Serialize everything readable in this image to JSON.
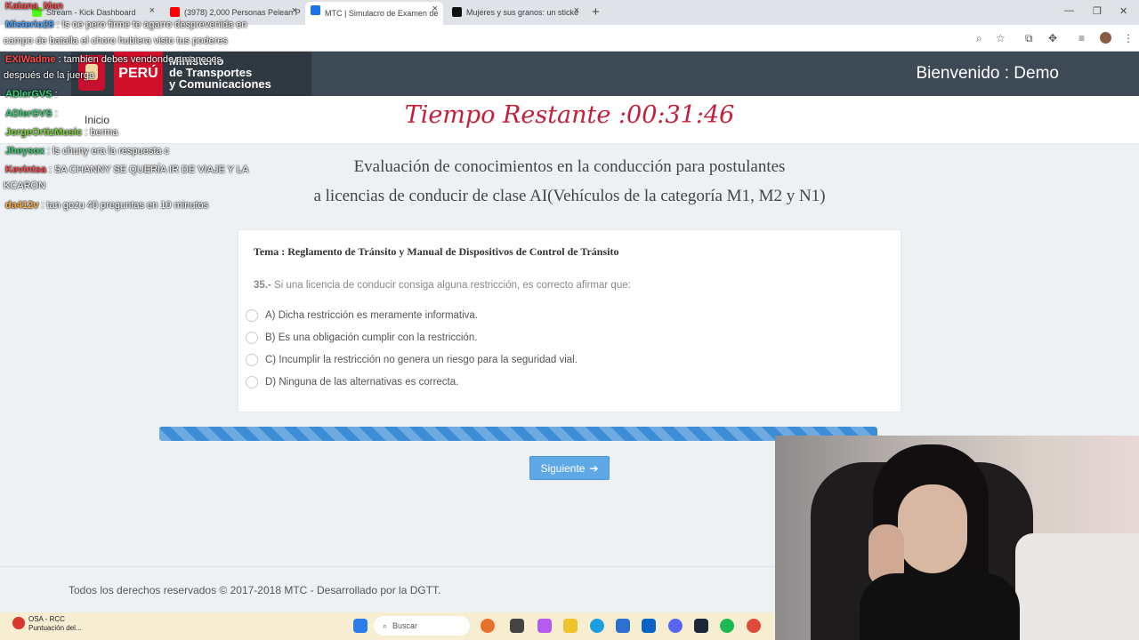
{
  "browser": {
    "tabs": [
      {
        "label": "Stream - Kick Dashboard",
        "color": "#53fc18"
      },
      {
        "label": "(3978) 2,000 Personas Pelean P",
        "color": "#ff0000"
      },
      {
        "label": "MTC | Simulacro de Examen de",
        "color": "#1a73e8"
      },
      {
        "label": "Mujeres y sus granos: un sticke",
        "color": "#111111"
      }
    ]
  },
  "header": {
    "logo_peru": "PERÚ",
    "logo_ministry_line1": "Ministerio",
    "logo_ministry_line2": "de Transportes",
    "logo_ministry_line3": "y Comunicaciones",
    "welcome": "Bienvenido : Demo"
  },
  "nav": {
    "inicio": "Inicio"
  },
  "timer": {
    "label": "Tiempo Restante :",
    "value": "00:31:46"
  },
  "exam": {
    "title_line1": "Evaluación de conocimientos en la conducción para postulantes",
    "title_line2": "a licencias de conducir de clase AI(Vehículos de la categoría M1, M2 y N1)",
    "tema": "Tema : Reglamento de Tránsito y Manual de Dispositivos de Control de Tránsito",
    "question_number": "35.-",
    "question_text": "Si una licencia de conducir consiga alguna restricción, es correcto afirmar que:",
    "options": [
      "A) Dicha restricción es meramente informativa.",
      "B) Es una obligación cumplir con la restricción.",
      "C) Incumplir la restricción no genera un riesgo para la seguridad vial.",
      "D) Ninguna de las alternativas es correcta."
    ],
    "progress_percent": 100,
    "next_label": "Siguiente"
  },
  "footer": {
    "text": "Todos los derechos reservados © 2017-2018 MTC - Desarrollado por la DGTT."
  },
  "taskbar": {
    "app_title": "OSA - RCC",
    "app_subtitle": "Puntuación del...",
    "search_placeholder": "Buscar"
  },
  "chat": [
    {
      "user": "Katana_Man",
      "msg": "",
      "color": "#ff4d4d"
    },
    {
      "user": "Misterio28",
      "msg": ": Is oe pero firme te agarro desprevenida en",
      "color": "#4da6ff"
    },
    {
      "user": "",
      "msg": "campo de batalla el choro hubiera visto tus poderes",
      "color": "#ffffff"
    },
    {
      "user": "EXIWadme",
      "msg": ": tambien debes vendonde amaneces",
      "color": "#ff4d4d"
    },
    {
      "user": "",
      "msg": "después de la juerga",
      "color": "#ffffff"
    },
    {
      "user": "ADlerGVS",
      "msg": ":",
      "color": "#3fd07a"
    },
    {
      "user": "ADlerGVS",
      "msg": ":",
      "color": "#3fd07a"
    },
    {
      "user": "JorgeOrtizMusic",
      "msg": ": berma",
      "color": "#7bd13f"
    },
    {
      "user": "Jheysox",
      "msg": ": ls chuny era la respuesta c",
      "color": "#3fd07a"
    },
    {
      "user": "Kevintsa",
      "msg": ": SA CHANNY SE QUERÍA IR DE VIAJE Y LA",
      "color": "#ff4d4d"
    },
    {
      "user": "",
      "msg": "KCARON",
      "color": "#ffffff"
    },
    {
      "user": "da412v",
      "msg": ": tan gozu 40 preguntas en 10 minutos",
      "color": "#ffb347"
    }
  ]
}
